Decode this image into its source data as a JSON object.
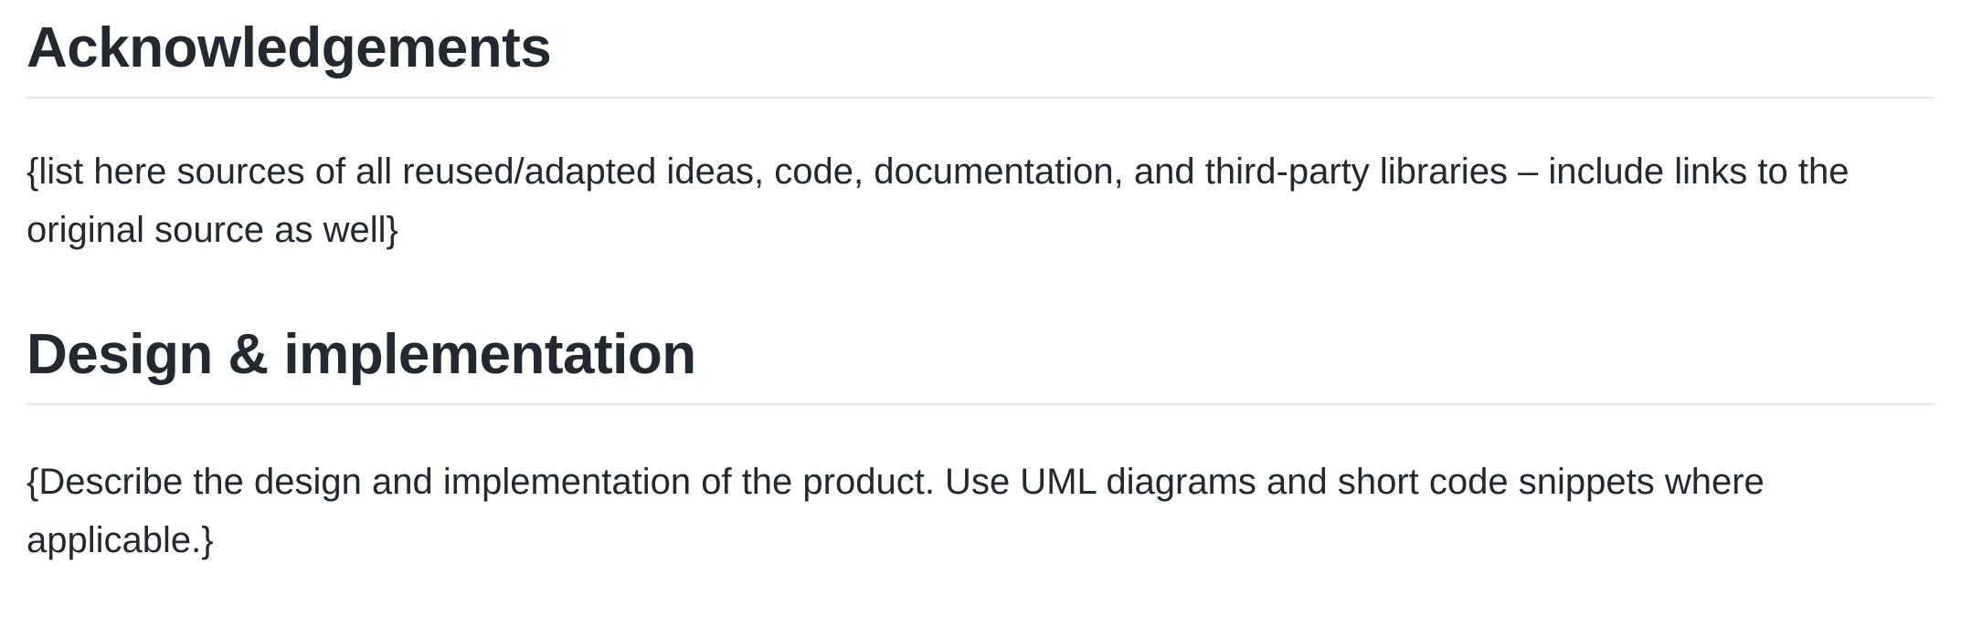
{
  "sections": [
    {
      "heading": "Acknowledgements",
      "body": "{list here sources of all reused/adapted ideas, code, documentation, and third-party libraries – include links to the original source as well}"
    },
    {
      "heading": "Design & implementation",
      "body": "{Describe the design and implementation of the product. Use UML diagrams and short code snippets where applicable.}"
    }
  ]
}
